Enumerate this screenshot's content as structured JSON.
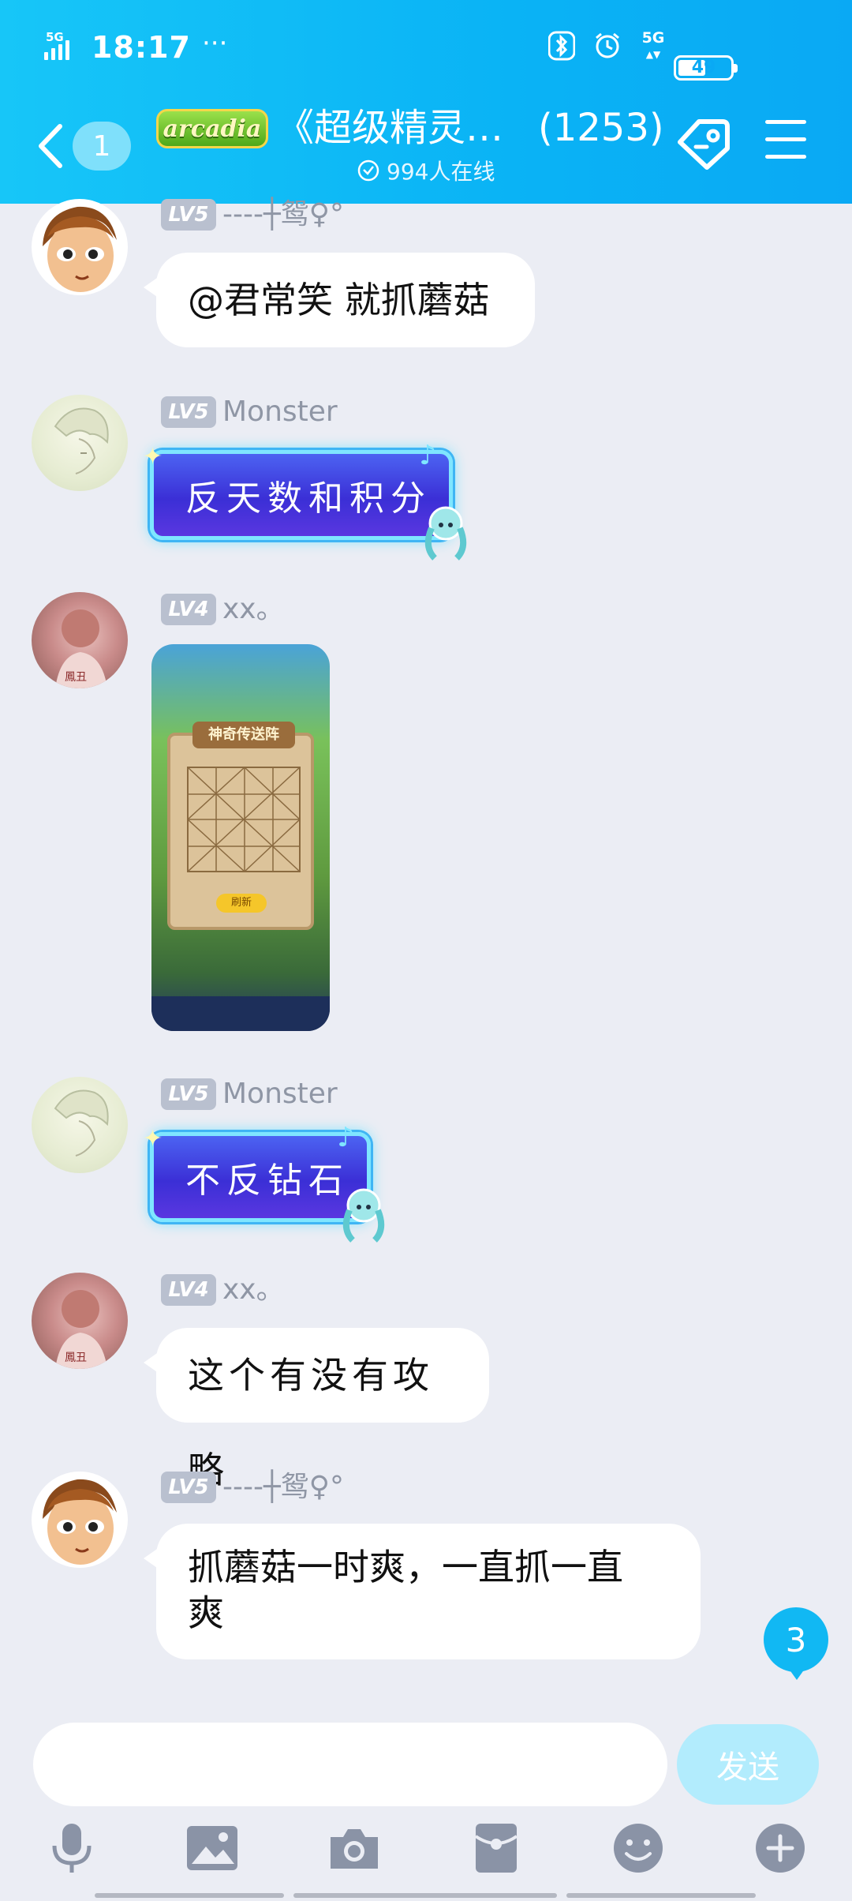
{
  "status_bar": {
    "network_label": "5G",
    "time": "18:17",
    "overflow": "···",
    "right_network_label": "5G",
    "battery": "49"
  },
  "header": {
    "back_badge": "1",
    "group_logo_text": "arcadia",
    "group_title": "《超级精灵…",
    "member_count": "(1253)",
    "online_text": "994人在线"
  },
  "messages": [
    {
      "level": "LV5",
      "nick": "----┼鸳♀°",
      "text": "@君常笑 就抓蘑菇"
    },
    {
      "level": "LV5",
      "nick": "Monster",
      "text": "反天数和积分"
    },
    {
      "level": "LV4",
      "nick": "xx。",
      "image_title": "神奇传送阵",
      "image_button": "刷新"
    },
    {
      "level": "LV5",
      "nick": "Monster",
      "text": "不反钻石"
    },
    {
      "level": "LV4",
      "nick": "xx。",
      "text": "这个有没有攻略"
    },
    {
      "level": "LV5",
      "nick": "----┼鸳♀°",
      "text_line1": "抓蘑菇一时爽，一直抓一直",
      "text_line2": "爽"
    }
  ],
  "unread_count": "3",
  "input": {
    "value": "",
    "send_label": "发送"
  },
  "toolbar": [
    "microphone-icon",
    "image-icon",
    "camera-icon",
    "red-packet-icon",
    "emoji-icon",
    "plus-icon"
  ],
  "colors": {
    "header": "#0ab3f5",
    "bubble": "#ffffff",
    "background": "#ebedf4",
    "accent": "#11b8f3"
  }
}
